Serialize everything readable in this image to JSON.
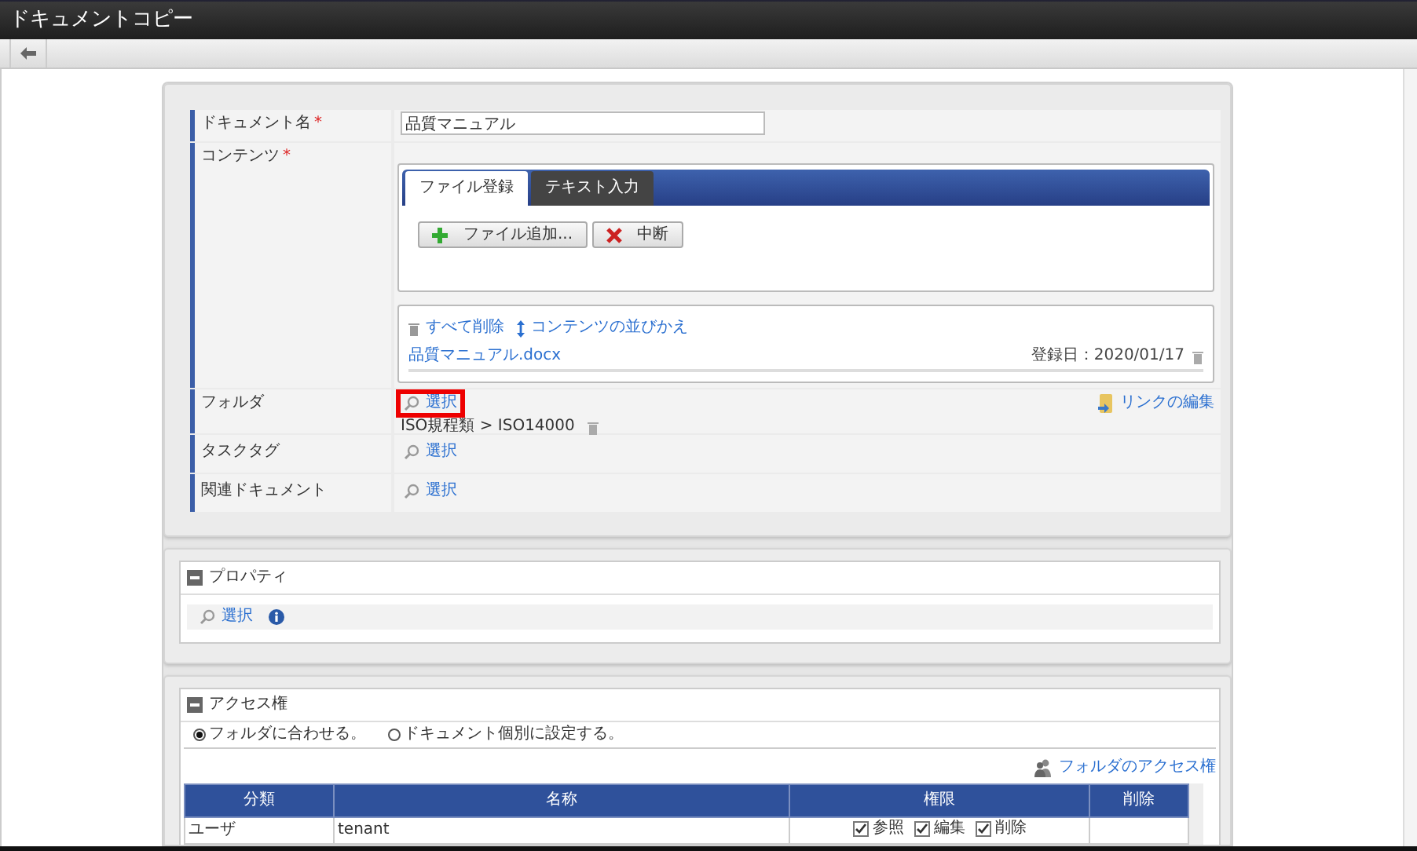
{
  "window": {
    "title": "ドキュメントコピー"
  },
  "form": {
    "rows": [
      {
        "kind": "text_input",
        "label": "ドキュメント名",
        "required_mark": "*",
        "value": "品質マニュアル"
      },
      {
        "kind": "contents",
        "label": "コンテンツ",
        "required_mark": "*",
        "tabs": [
          {
            "label": "ファイル登録",
            "selected": true
          },
          {
            "label": "テキスト入力",
            "selected": false
          }
        ],
        "buttons": [
          {
            "kind": "add",
            "label": "ファイル追加..."
          },
          {
            "kind": "cancel",
            "label": "中断"
          }
        ],
        "actions": [
          {
            "kind": "delete",
            "label": "すべて削除"
          },
          {
            "kind": "sort",
            "label": "コンテンツの並びかえ"
          }
        ],
        "files": [
          {
            "name": "品質マニュアル.docx",
            "date": "登録日：2020/01/17"
          }
        ]
      },
      {
        "kind": "folder",
        "label": "フォルダ",
        "select": "選択",
        "highlighted": true,
        "path": "ISO規程類 > ISO14000",
        "link": "リンクの編集"
      },
      {
        "kind": "select",
        "label": "タスクタグ",
        "select": "選択"
      },
      {
        "kind": "select",
        "label": "関連ドキュメント",
        "select": "選択"
      }
    ]
  },
  "properties": {
    "title": "プロパティ",
    "expanded": true,
    "select": "選択"
  },
  "access": {
    "title": "アクセス権",
    "expanded": true,
    "radios": [
      {
        "label": "フォルダに合わせる。",
        "selected": true
      },
      {
        "label": "ドキュメント個別に設定する。",
        "selected": false
      }
    ],
    "link": "フォルダのアクセス権",
    "columns": [
      "分類",
      "名称",
      "権限",
      "削除"
    ],
    "rows": [
      {
        "category": "ユーザ",
        "name": "tenant",
        "permissions": [
          {
            "label": "参照",
            "checked": true
          },
          {
            "label": "編集",
            "checked": true
          },
          {
            "label": "削除",
            "checked": true
          }
        ]
      }
    ]
  }
}
